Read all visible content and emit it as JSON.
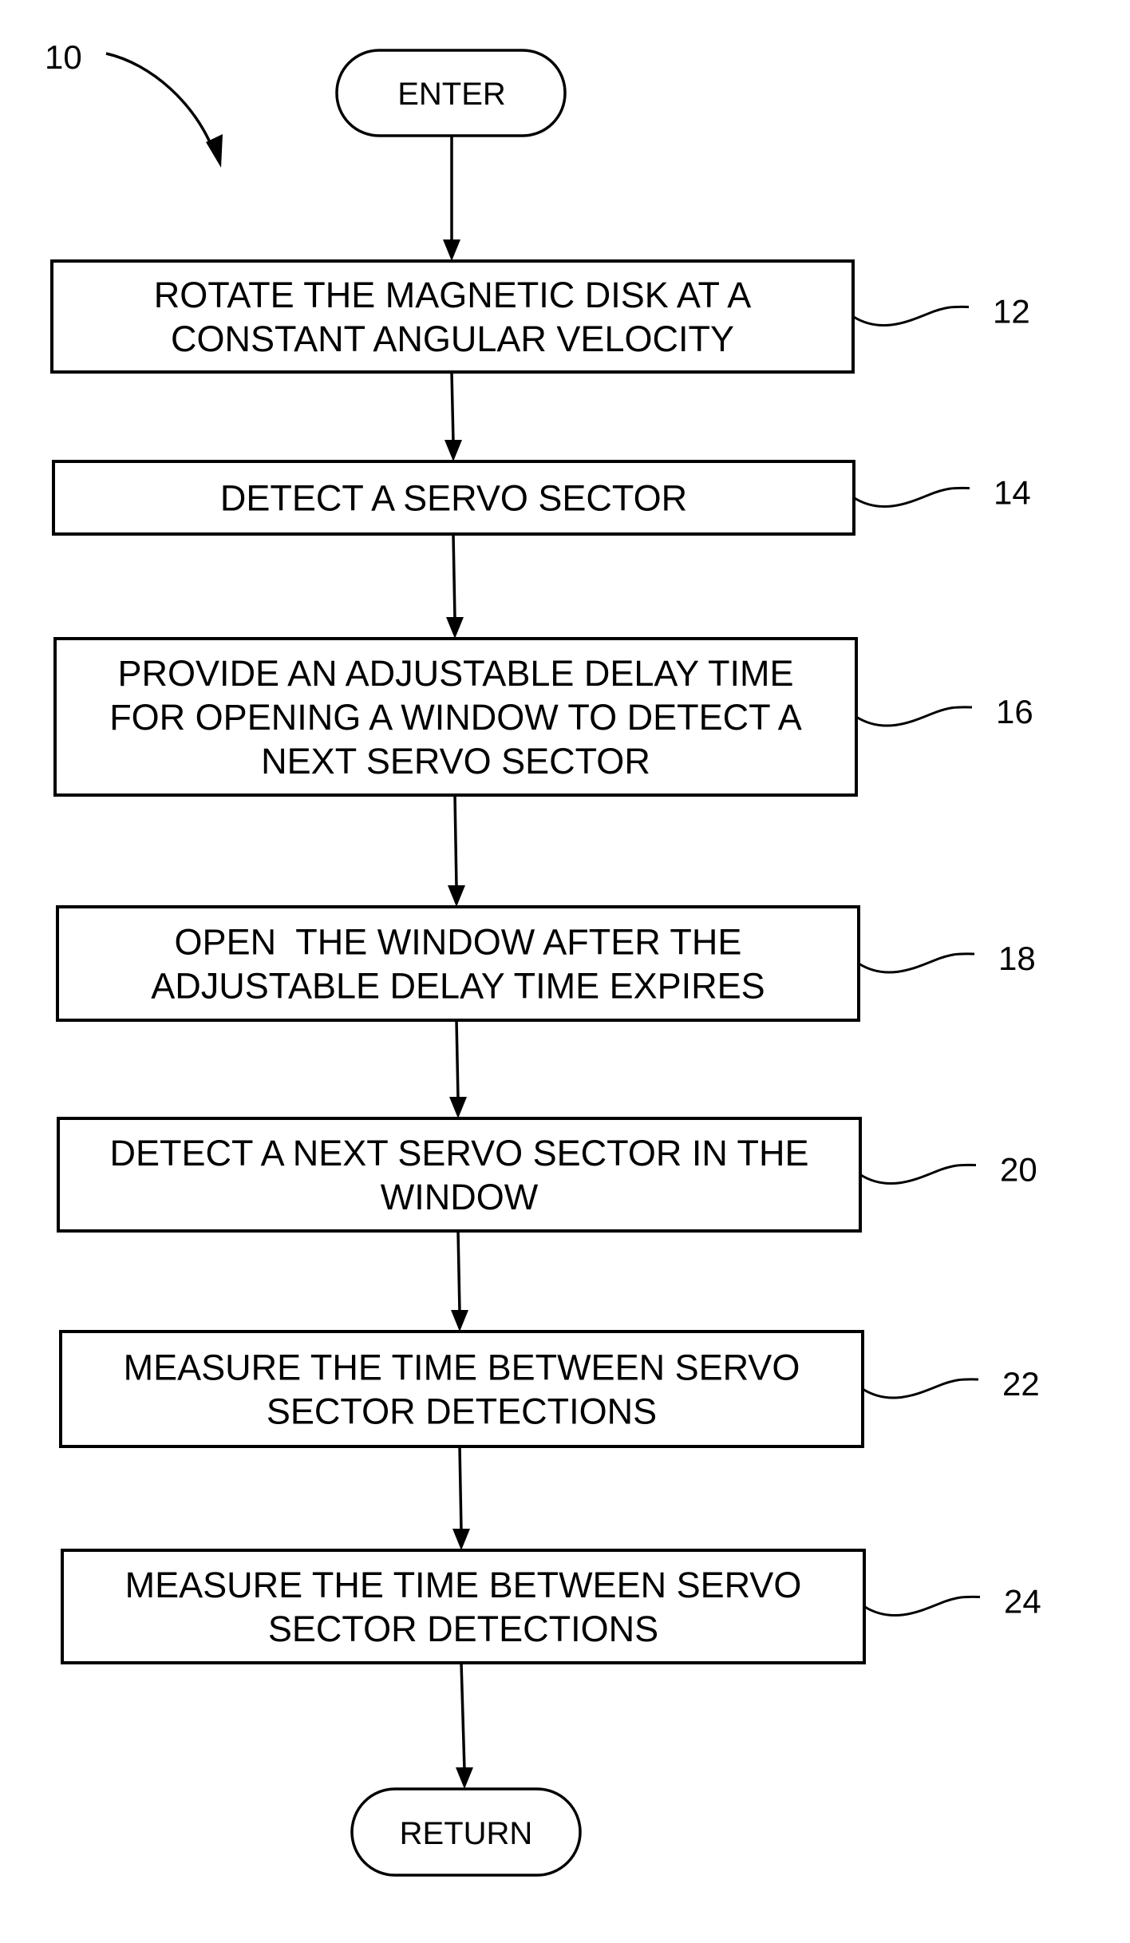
{
  "figure": {
    "reference": "10",
    "start": {
      "label": "ENTER"
    },
    "end": {
      "label": "RETURN"
    },
    "steps": [
      {
        "id": "12",
        "lines": [
          "ROTATE THE MAGNETIC DISK AT A",
          "CONSTANT ANGULAR VELOCITY"
        ]
      },
      {
        "id": "14",
        "lines": [
          "DETECT A SERVO SECTOR"
        ]
      },
      {
        "id": "16",
        "lines": [
          "PROVIDE AN ADJUSTABLE DELAY TIME",
          "FOR OPENING A WINDOW TO DETECT A",
          "NEXT SERVO SECTOR"
        ]
      },
      {
        "id": "18",
        "lines": [
          "OPEN  THE WINDOW AFTER THE",
          "ADJUSTABLE DELAY TIME EXPIRES"
        ]
      },
      {
        "id": "20",
        "lines": [
          "DETECT A NEXT SERVO SECTOR IN THE",
          "WINDOW"
        ]
      },
      {
        "id": "22",
        "lines": [
          "MEASURE THE TIME BETWEEN SERVO",
          "SECTOR DETECTIONS"
        ]
      },
      {
        "id": "24",
        "lines": [
          "MEASURE THE TIME BETWEEN SERVO",
          "SECTOR DETECTIONS"
        ]
      }
    ]
  }
}
